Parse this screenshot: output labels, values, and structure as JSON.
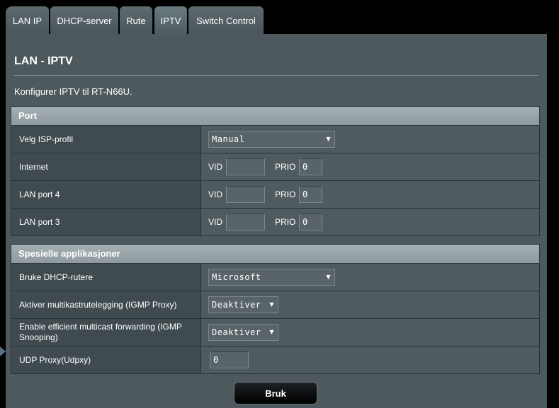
{
  "tabs": [
    {
      "label": "LAN IP",
      "active": false
    },
    {
      "label": "DHCP-server",
      "active": false
    },
    {
      "label": "Rute",
      "active": false
    },
    {
      "label": "IPTV",
      "active": true
    },
    {
      "label": "Switch Control",
      "active": false
    }
  ],
  "page": {
    "title": "LAN - IPTV",
    "description": "Konfigurer IPTV til RT-N66U."
  },
  "port_section": {
    "header": "Port",
    "isp_profile": {
      "label": "Velg ISP-profil",
      "value": "Manual"
    },
    "rows": [
      {
        "label": "Internet",
        "vid_label": "VID",
        "vid": "",
        "prio_label": "PRIO",
        "prio": "0"
      },
      {
        "label": "LAN port 4",
        "vid_label": "VID",
        "vid": "",
        "prio_label": "PRIO",
        "prio": "0"
      },
      {
        "label": "LAN port 3",
        "vid_label": "VID",
        "vid": "",
        "prio_label": "PRIO",
        "prio": "0"
      }
    ]
  },
  "special_section": {
    "header": "Spesielle applikasjoner",
    "dhcp_routes": {
      "label": "Bruke DHCP-rutere",
      "value": "Microsoft"
    },
    "igmp_proxy": {
      "label": "Aktiver multikastrutelegging (IGMP Proxy)",
      "value": "Deaktiver"
    },
    "igmp_snooping": {
      "label": "Enable efficient multicast forwarding (IGMP Snooping)",
      "value": "Deaktiver"
    },
    "udpxy": {
      "label": "UDP Proxy(Udpxy)",
      "value": "0"
    }
  },
  "apply_button": "Bruk",
  "icons": {
    "dropdown": "chevron-down-icon"
  },
  "colors": {
    "panel": "#4d595d",
    "header": "#9aa6a9",
    "label_cell": "#3f4b4f"
  }
}
